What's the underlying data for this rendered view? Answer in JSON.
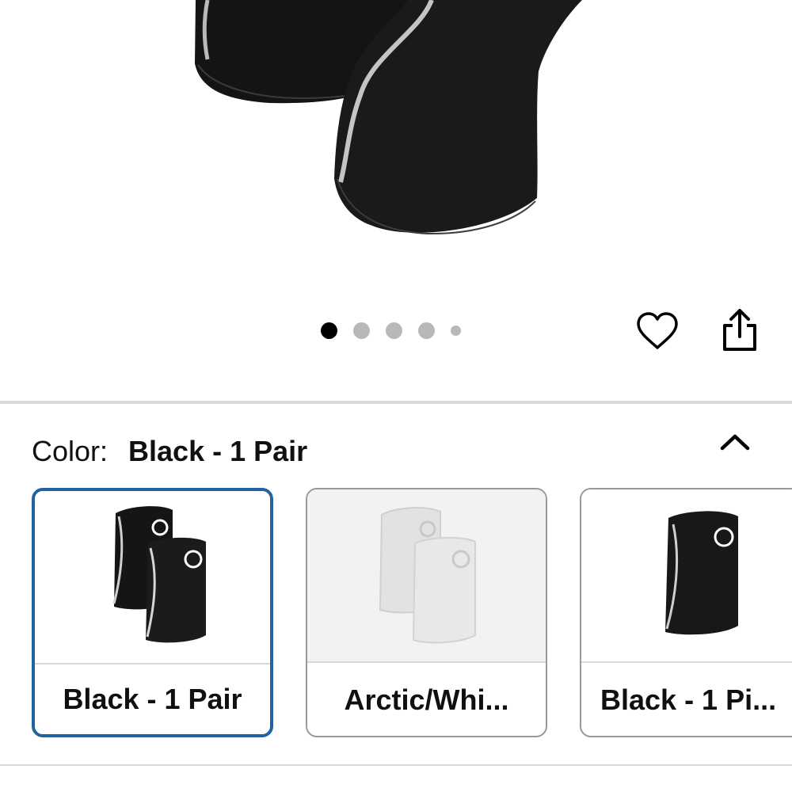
{
  "carousel": {
    "dot_count": 5,
    "active_index": 0
  },
  "actions": {
    "favorite_icon": "heart-icon",
    "share_icon": "share-icon"
  },
  "variation": {
    "label": "Color:",
    "selected_value": "Black - 1 Pair",
    "collapse_icon": "chevron-up-icon",
    "options": [
      {
        "label": "Black - 1 Pair",
        "selected": true
      },
      {
        "label": "Arctic/Whi...",
        "selected": false
      },
      {
        "label": "Black - 1 Pi...",
        "selected": false
      }
    ]
  },
  "colors": {
    "selected_border": "#2162a1",
    "divider": "#d5dbdb",
    "inactive_dot": "#b8b8b8"
  }
}
